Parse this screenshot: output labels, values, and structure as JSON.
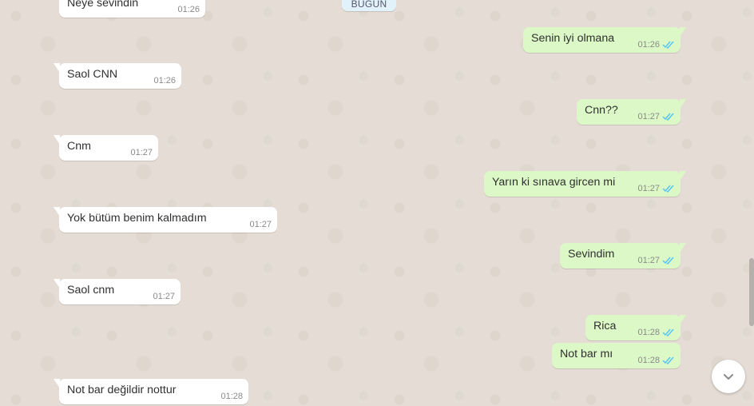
{
  "date_chip": "BUGÜN",
  "incoming": [
    {
      "text": "Neye sevindin",
      "time": "01:26"
    },
    {
      "text": "Saol CNN",
      "time": "01:26"
    },
    {
      "text": "Cnm",
      "time": "01:27"
    },
    {
      "text": "Yok bütüm benim kalmadım",
      "time": "01:27"
    },
    {
      "text": "Saol cnm",
      "time": "01:27"
    },
    {
      "text": "Not bar değildir nottur",
      "time": "01:28"
    }
  ],
  "outgoing": [
    {
      "text": "Senin iyi olmana",
      "time": "01:26"
    },
    {
      "text": "Cnn??",
      "time": "01:27"
    },
    {
      "text": "Yarın ki sınava gircen mi",
      "time": "01:27"
    },
    {
      "text": "Sevindim",
      "time": "01:27"
    },
    {
      "text": "Rica",
      "time": "01:28"
    },
    {
      "text": "Not bar mı",
      "time": "01:28"
    }
  ],
  "icons": {
    "read_ticks": "double-check-icon",
    "scroll_down": "chevron-down-icon"
  },
  "colors": {
    "incoming": "#ffffff",
    "outgoing": "#dcf8c6",
    "background": "#e5ddd5",
    "read_ticks": "#4fc3f7"
  }
}
